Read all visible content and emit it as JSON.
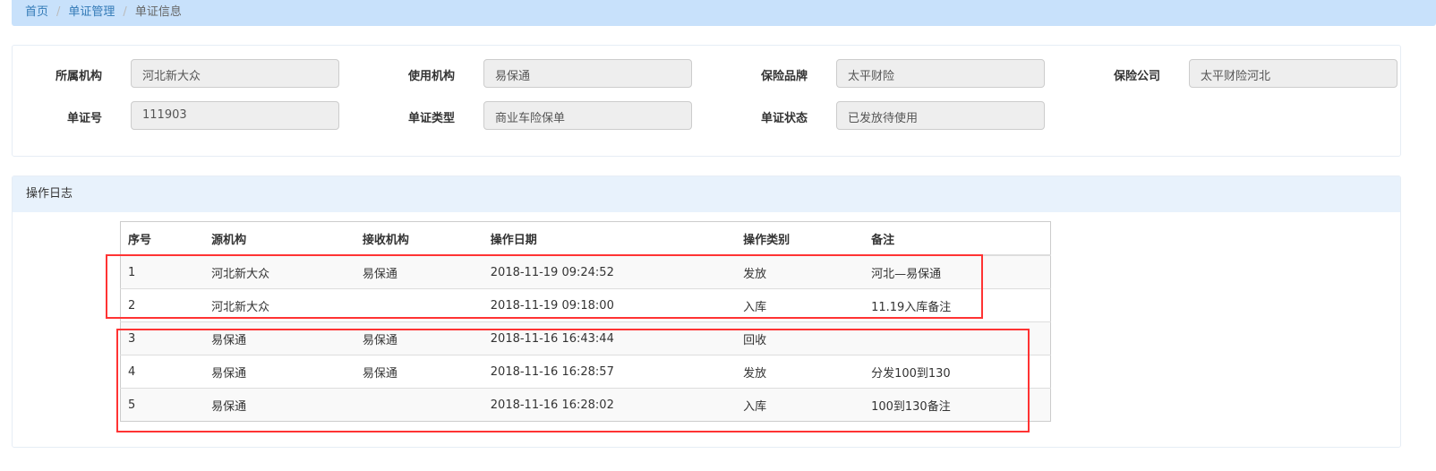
{
  "breadcrumb": [
    "首页",
    "单证管理",
    "单证信息"
  ],
  "fields": [
    {
      "label": "所属机构",
      "value": "河北新大众"
    },
    {
      "label": "使用机构",
      "value": "易保通"
    },
    {
      "label": "保险品牌",
      "value": "太平财险"
    },
    {
      "label": "保险公司",
      "value": "太平财险河北"
    },
    {
      "label": "单证号",
      "value": "111903"
    },
    {
      "label": "单证类型",
      "value": "商业车险保单"
    },
    {
      "label": "单证状态",
      "value": "已发放待使用"
    }
  ],
  "log": {
    "title": "操作日志",
    "headers": [
      "序号",
      "源机构",
      "接收机构",
      "操作日期",
      "操作类别",
      "备注"
    ],
    "rows": [
      [
        "1",
        "河北新大众",
        "易保通",
        "2018-11-19 09:24:52",
        "发放",
        "河北—易保通"
      ],
      [
        "2",
        "河北新大众",
        "",
        "2018-11-19 09:18:00",
        "入库",
        "11.19入库备注"
      ],
      [
        "3",
        "易保通",
        "易保通",
        "2018-11-16 16:43:44",
        "回收",
        ""
      ],
      [
        "4",
        "易保通",
        "易保通",
        "2018-11-16 16:28:57",
        "发放",
        "分发100到130"
      ],
      [
        "5",
        "易保通",
        "",
        "2018-11-16 16:28:02",
        "入库",
        "100到130备注"
      ]
    ]
  },
  "colors": {
    "highlight": "#ff3333",
    "breadcrumb_bg": "#c8e1fb"
  }
}
